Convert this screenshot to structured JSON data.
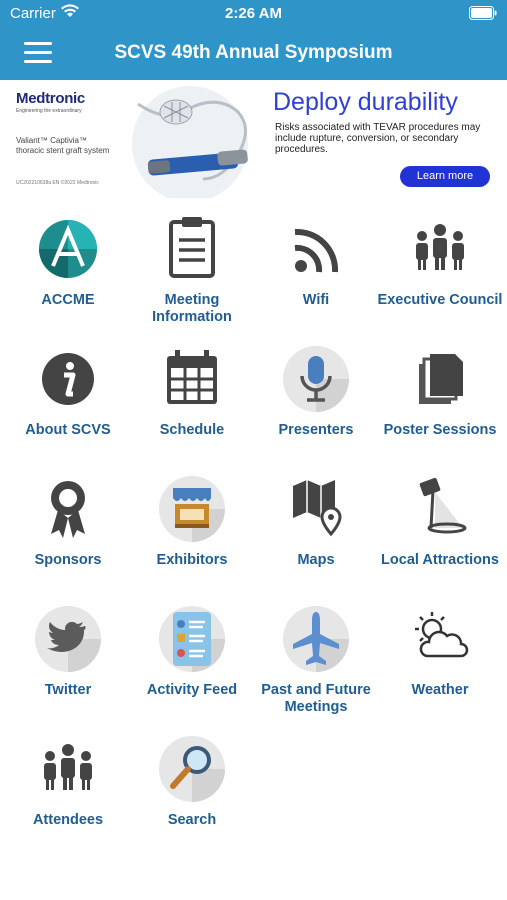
{
  "status_bar": {
    "carrier": "Carrier",
    "time": "2:26 AM"
  },
  "nav": {
    "title": "SCVS 49th Annual Symposium",
    "menu_icon": "hamburger-menu-icon"
  },
  "ad": {
    "brand": "Medtronic",
    "tagline": "Engineering the extraordinary",
    "product_line1": "Valiant™ Captivia™",
    "product_line2": "thoracic stent graft system",
    "legal_code": "UC202210638a EN ©2022 Medtronic",
    "headline": "Deploy durability",
    "body": "Risks associated with TEVAR procedures may include rupture, conversion, or secondary procedures.",
    "cta": "Learn more"
  },
  "grid": [
    {
      "label": "ACCME",
      "icon": "accme-logo-icon"
    },
    {
      "label": "Meeting Information",
      "icon": "clipboard-icon"
    },
    {
      "label": "Wifi",
      "icon": "wifi-icon"
    },
    {
      "label": "Executive Council",
      "icon": "people-group-icon"
    },
    {
      "label": "About SCVS",
      "icon": "info-icon"
    },
    {
      "label": "Schedule",
      "icon": "calendar-icon"
    },
    {
      "label": "Presenters",
      "icon": "microphone-icon"
    },
    {
      "label": "Poster Sessions",
      "icon": "documents-icon"
    },
    {
      "label": "Sponsors",
      "icon": "award-ribbon-icon"
    },
    {
      "label": "Exhibitors",
      "icon": "booth-icon"
    },
    {
      "label": "Maps",
      "icon": "map-pin-icon"
    },
    {
      "label": "Local Attractions",
      "icon": "spotlight-icon"
    },
    {
      "label": "Twitter",
      "icon": "twitter-bird-icon"
    },
    {
      "label": "Activity Feed",
      "icon": "activity-feed-icon"
    },
    {
      "label": "Past and Future Meetings",
      "icon": "airplane-icon"
    },
    {
      "label": "Weather",
      "icon": "sun-cloud-icon"
    },
    {
      "label": "Attendees",
      "icon": "attendees-icon"
    },
    {
      "label": "Search",
      "icon": "magnifier-icon"
    }
  ]
}
